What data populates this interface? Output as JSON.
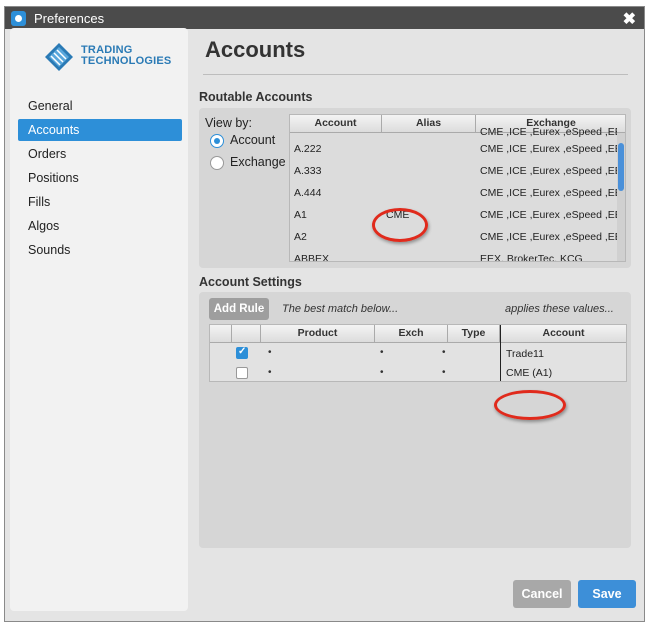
{
  "window": {
    "title": "Preferences",
    "close_glyph": "✖"
  },
  "logo": {
    "line1": "TRADING",
    "line2": "TECHNOLOGIES"
  },
  "sidebar": {
    "items": [
      {
        "label": "General",
        "active": false
      },
      {
        "label": "Accounts",
        "active": true
      },
      {
        "label": "Orders",
        "active": false
      },
      {
        "label": "Positions",
        "active": false
      },
      {
        "label": "Fills",
        "active": false
      },
      {
        "label": "Algos",
        "active": false
      },
      {
        "label": "Sounds",
        "active": false
      }
    ]
  },
  "main": {
    "title": "Accounts",
    "routable": {
      "label": "Routable Accounts",
      "view_by_label": "View by:",
      "options": [
        {
          "label": "Account",
          "selected": true
        },
        {
          "label": "Exchange",
          "selected": false
        }
      ],
      "columns": [
        "Account",
        "Alias",
        "Exchange"
      ],
      "rows": [
        {
          "account": "A.222",
          "alias": "",
          "exchange": "CME ,ICE ,Eurex ,eSpeed ,EEX"
        },
        {
          "account": "A.333",
          "alias": "",
          "exchange": "CME ,ICE ,Eurex ,eSpeed ,EEX"
        },
        {
          "account": "A.444",
          "alias": "",
          "exchange": "CME ,ICE ,Eurex ,eSpeed ,EEX"
        },
        {
          "account": "A1",
          "alias": "CME",
          "exchange": "CME ,ICE ,Eurex ,eSpeed ,EEX"
        },
        {
          "account": "A2",
          "alias": "",
          "exchange": "CME ,ICE ,Eurex ,eSpeed ,EEX"
        },
        {
          "account": "ABBEX",
          "alias": "",
          "exchange": "EEX, BrokerTec, KCG"
        }
      ],
      "top_partial_exchange": "CME ,ICE ,Eurex ,eSpeed ,EEX"
    },
    "settings": {
      "label": "Account Settings",
      "add_rule": "Add Rule",
      "hint_left": "The best match below...",
      "hint_right": "applies these values...",
      "columns": [
        "",
        "Product",
        "Exch",
        "Type",
        "Account"
      ],
      "rows": [
        {
          "checked": true,
          "product": "•",
          "exch": "•",
          "type": "•",
          "account": "Trade11"
        },
        {
          "checked": false,
          "product": "•",
          "exch": "•",
          "type": "•",
          "account": "CME (A1)"
        }
      ]
    }
  },
  "buttons": {
    "cancel": "Cancel",
    "save": "Save"
  },
  "colors": {
    "accent": "#2d8fd8",
    "highlight": "#e02a1c",
    "titlebar": "#4b4b4b"
  }
}
